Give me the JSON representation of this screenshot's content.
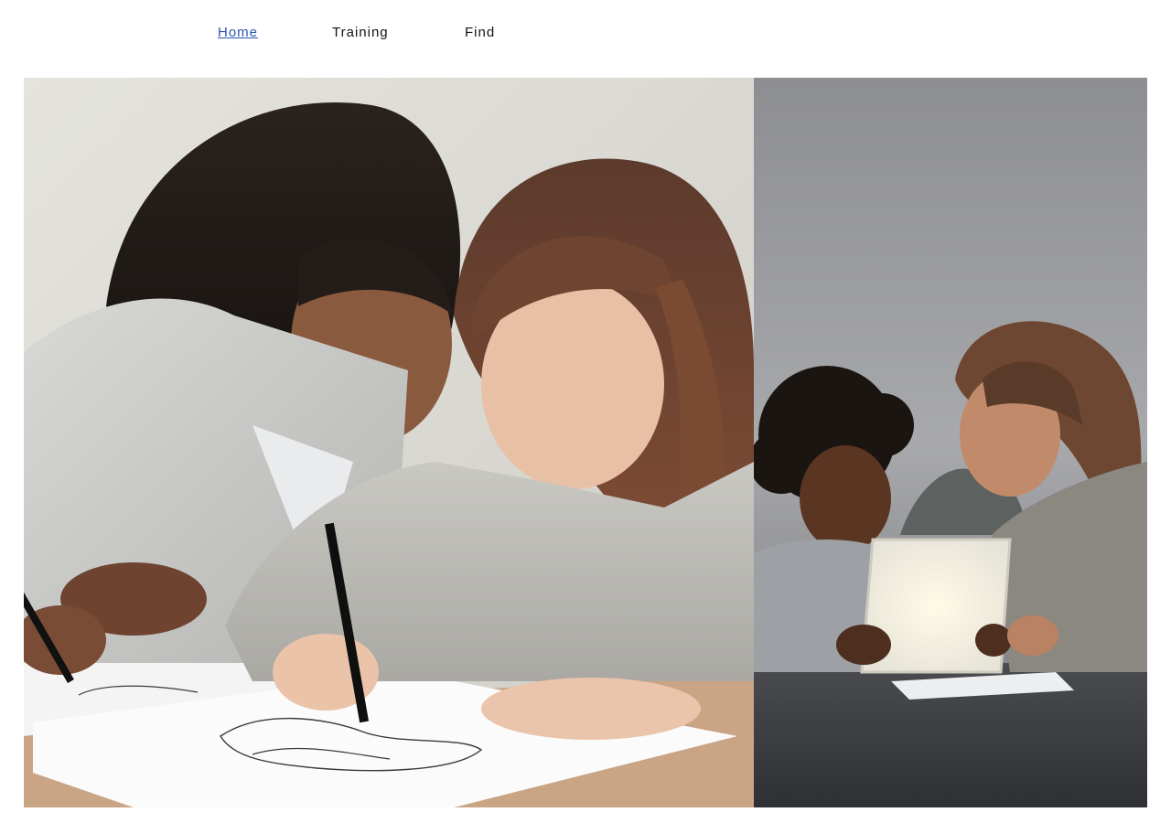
{
  "nav": {
    "items": [
      {
        "label": "Home",
        "active": true
      },
      {
        "label": "Training",
        "active": false
      },
      {
        "label": "Find",
        "active": false
      }
    ]
  },
  "gallery": {
    "photos": [
      {
        "subject": "two-women-drawing-together-photo"
      },
      {
        "subject": "child-and-woman-using-tablet-photo"
      }
    ]
  },
  "colors": {
    "nav_text": "#111111",
    "nav_active": "#2a56b0",
    "background": "#ffffff"
  }
}
